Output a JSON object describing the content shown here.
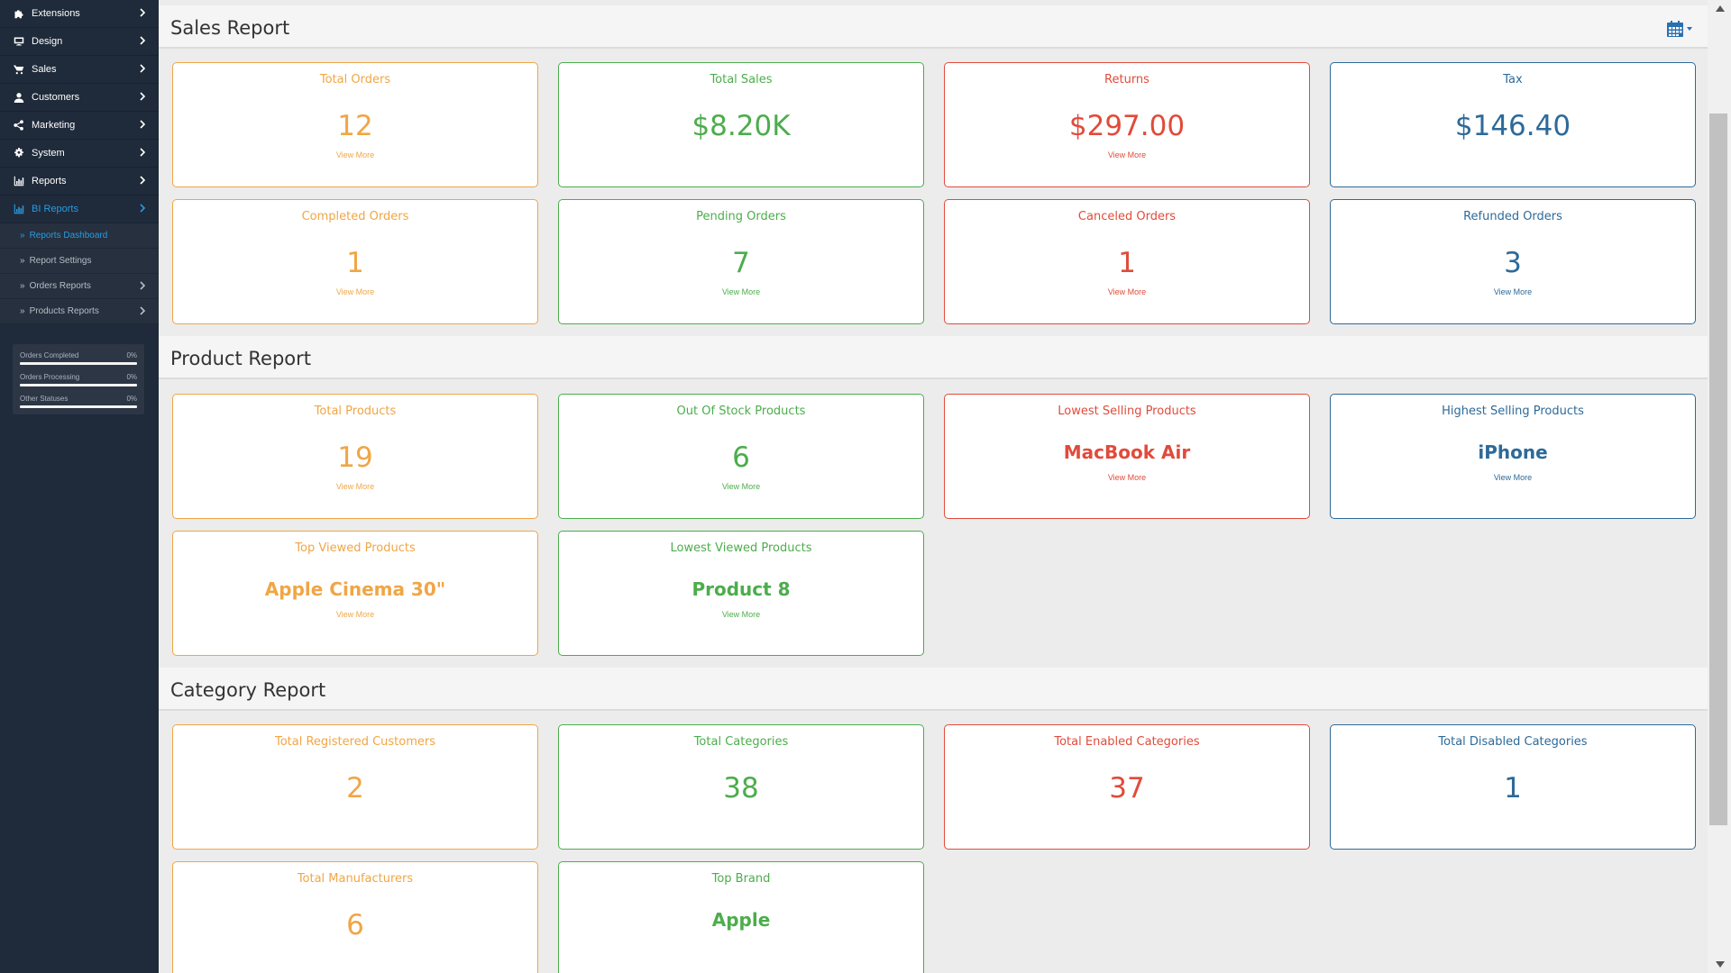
{
  "sidebar": {
    "items": [
      {
        "label": "Extensions",
        "icon": "puzzle-icon"
      },
      {
        "label": "Design",
        "icon": "monitor-icon"
      },
      {
        "label": "Sales",
        "icon": "cart-icon"
      },
      {
        "label": "Customers",
        "icon": "user-icon"
      },
      {
        "label": "Marketing",
        "icon": "share-icon"
      },
      {
        "label": "System",
        "icon": "gear-icon"
      },
      {
        "label": "Reports",
        "icon": "bar-chart-icon"
      },
      {
        "label": "BI Reports",
        "icon": "bar-chart-icon"
      }
    ],
    "sub_items": [
      {
        "label": "Reports Dashboard"
      },
      {
        "label": "Report Settings"
      },
      {
        "label": "Orders Reports"
      },
      {
        "label": "Products Reports"
      }
    ],
    "stats": [
      {
        "label": "Orders Completed",
        "pct": "0%"
      },
      {
        "label": "Orders Processing",
        "pct": "0%"
      },
      {
        "label": "Other Statuses",
        "pct": "0%"
      }
    ]
  },
  "sections": {
    "sales": {
      "title": "Sales Report"
    },
    "product": {
      "title": "Product Report"
    },
    "category": {
      "title": "Category Report"
    }
  },
  "view_more": "View More",
  "sales_cards": [
    {
      "title": "Total Orders",
      "value": "12"
    },
    {
      "title": "Total Sales",
      "value": "$8.20K"
    },
    {
      "title": "Returns",
      "value": "$297.00"
    },
    {
      "title": "Tax",
      "value": "$146.40"
    },
    {
      "title": "Completed Orders",
      "value": "1"
    },
    {
      "title": "Pending Orders",
      "value": "7"
    },
    {
      "title": "Canceled Orders",
      "value": "1"
    },
    {
      "title": "Refunded Orders",
      "value": "3"
    }
  ],
  "product_cards": [
    {
      "title": "Total Products",
      "value": "19"
    },
    {
      "title": "Out Of Stock Products",
      "value": "6"
    },
    {
      "title": "Lowest Selling Products",
      "value": "MacBook Air"
    },
    {
      "title": "Highest Selling Products",
      "value": "iPhone"
    },
    {
      "title": "Top Viewed Products",
      "value": "Apple Cinema 30\""
    },
    {
      "title": "Lowest Viewed Products",
      "value": "Product 8"
    }
  ],
  "category_cards": [
    {
      "title": "Total Registered Customers",
      "value": "2"
    },
    {
      "title": "Total Categories",
      "value": "38"
    },
    {
      "title": "Total Enabled Categories",
      "value": "37"
    },
    {
      "title": "Total Disabled Categories",
      "value": "1"
    },
    {
      "title": "Total Manufacturers",
      "value": "6"
    },
    {
      "title": "Top Brand",
      "value": "Apple"
    }
  ],
  "colors": {
    "sidebar_bg": "#1f2a3a",
    "active": "#2a9be0",
    "orange": "#f0a645",
    "green": "#4cad4c",
    "red": "#e14b3b",
    "blue": "#2d6a99"
  }
}
